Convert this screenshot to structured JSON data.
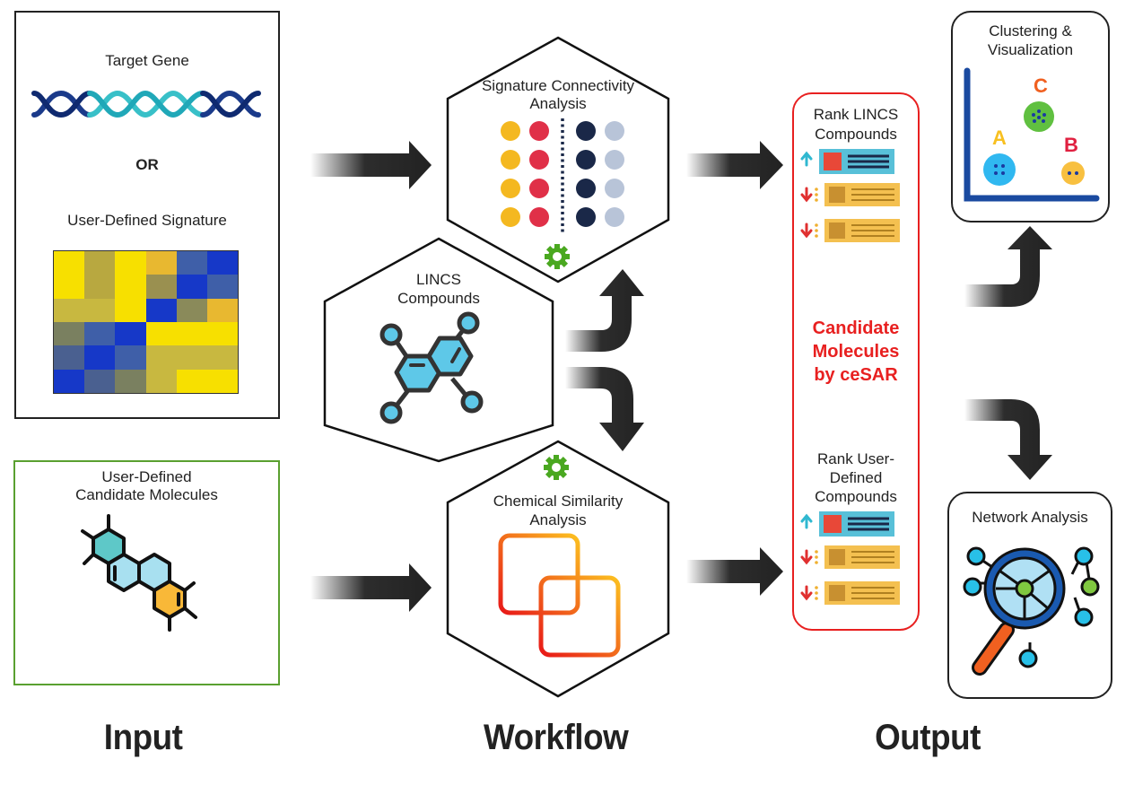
{
  "input": {
    "box1": {
      "title": "Target Gene",
      "or_label": "OR",
      "signature_label": "User-Defined Signature"
    },
    "heatmap": {
      "rows": [
        [
          "#f7e000",
          "#b8a840",
          "#f7e000",
          "#e8b830",
          "#3f5fa8",
          "#1638c8"
        ],
        [
          "#f7e000",
          "#b8a840",
          "#f7e000",
          "#9a9050",
          "#1638c8",
          "#3f5fa8"
        ],
        [
          "#c8b840",
          "#c8b840",
          "#f7e000",
          "#1638c8",
          "#8a8a5a",
          "#e8b830"
        ],
        [
          "#7a8060",
          "#3f5fa8",
          "#1638c8",
          "#f7e000",
          "#f7e000",
          "#f7e000"
        ],
        [
          "#4a6090",
          "#1638c8",
          "#3f5fa8",
          "#c8b840",
          "#c8b840",
          "#c8b840"
        ],
        [
          "#1638c8",
          "#4a6090",
          "#7a8060",
          "#c8b840",
          "#f7e000",
          "#f7e000"
        ]
      ]
    },
    "box2": {
      "title": "User-Defined Candidate Molecules"
    }
  },
  "workflow": {
    "signature_hex": {
      "title_line1": "Signature Connectivity",
      "title_line2": "Analysis"
    },
    "lincs_hex": {
      "title_line1": "LINCS",
      "title_line2": "Compounds"
    },
    "chemical_hex": {
      "title_line1": "Chemical Similarity",
      "title_line2": "Analysis"
    },
    "dot_colors": [
      "#f4b820",
      "#e03048",
      "#1a2848",
      "#b8c4d8"
    ]
  },
  "output": {
    "panel": {
      "rank_lincs": [
        "Rank LINCS",
        "Compounds"
      ],
      "candidate": [
        "Candidate",
        "Molecules",
        "by ceSAR"
      ],
      "rank_user": [
        "Rank User-",
        "Defined",
        "Compounds"
      ],
      "border_color": "#e82020",
      "candidate_color": "#e82020"
    },
    "clustering": {
      "title_line1": "Clustering &",
      "title_line2": "Visualization",
      "clusters": [
        {
          "label": "A",
          "color": "#30b8f0",
          "label_color": "#f8c020"
        },
        {
          "label": "B",
          "color": "#f8c040",
          "label_color": "#e02040"
        },
        {
          "label": "C",
          "color": "#60c040",
          "label_color": "#f06020"
        }
      ]
    },
    "network": {
      "title": "Network Analysis"
    }
  },
  "sections": {
    "input": "Input",
    "workflow": "Workflow",
    "output": "Output"
  }
}
